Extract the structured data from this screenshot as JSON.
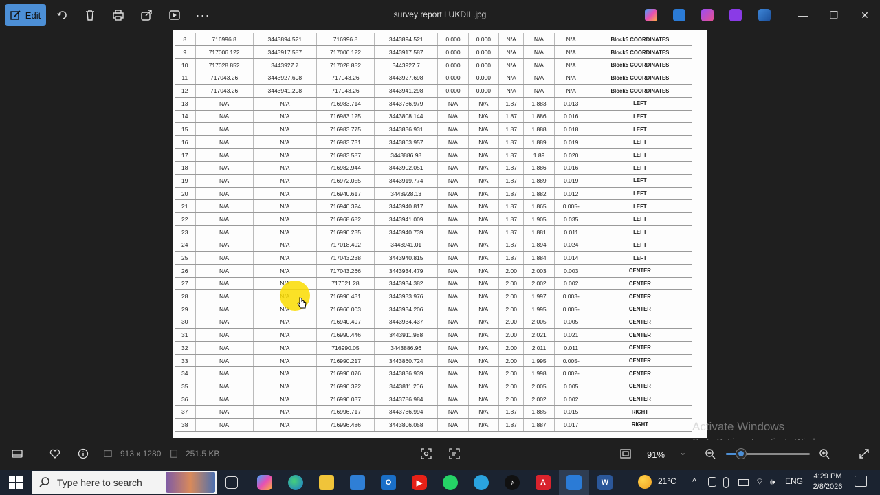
{
  "window": {
    "title": "survey report  LUKDIL.jpg",
    "edit_label": "Edit"
  },
  "table": {
    "rows": [
      [
        "8",
        "716996.8",
        "3443894.521",
        "716996.8",
        "3443894.521",
        "0.000",
        "0.000",
        "N/A",
        "N/A",
        "N/A",
        "Block5 COORDINATES"
      ],
      [
        "9",
        "717006.122",
        "3443917.587",
        "717006.122",
        "3443917.587",
        "0.000",
        "0.000",
        "N/A",
        "N/A",
        "N/A",
        "Block5 COORDINATES"
      ],
      [
        "10",
        "717028.852",
        "3443927.7",
        "717028.852",
        "3443927.7",
        "0.000",
        "0.000",
        "N/A",
        "N/A",
        "N/A",
        "Block5 COORDINATES"
      ],
      [
        "11",
        "717043.26",
        "3443927.698",
        "717043.26",
        "3443927.698",
        "0.000",
        "0.000",
        "N/A",
        "N/A",
        "N/A",
        "Block5 COORDINATES"
      ],
      [
        "12",
        "717043.26",
        "3443941.298",
        "717043.26",
        "3443941.298",
        "0.000",
        "0.000",
        "N/A",
        "N/A",
        "N/A",
        "Block5 COORDINATES"
      ],
      [
        "13",
        "N/A",
        "N/A",
        "716983.714",
        "3443786.979",
        "N/A",
        "N/A",
        "1.87",
        "1.883",
        "0.013",
        "LEFT"
      ],
      [
        "14",
        "N/A",
        "N/A",
        "716983.125",
        "3443808.144",
        "N/A",
        "N/A",
        "1.87",
        "1.886",
        "0.016",
        "LEFT"
      ],
      [
        "15",
        "N/A",
        "N/A",
        "716983.775",
        "3443836.931",
        "N/A",
        "N/A",
        "1.87",
        "1.888",
        "0.018",
        "LEFT"
      ],
      [
        "16",
        "N/A",
        "N/A",
        "716983.731",
        "3443863.957",
        "N/A",
        "N/A",
        "1.87",
        "1.889",
        "0.019",
        "LEFT"
      ],
      [
        "17",
        "N/A",
        "N/A",
        "716983.587",
        "3443886.98",
        "N/A",
        "N/A",
        "1.87",
        "1.89",
        "0.020",
        "LEFT"
      ],
      [
        "18",
        "N/A",
        "N/A",
        "716982.944",
        "3443902.051",
        "N/A",
        "N/A",
        "1.87",
        "1.886",
        "0.016",
        "LEFT"
      ],
      [
        "19",
        "N/A",
        "N/A",
        "716972.055",
        "3443919.774",
        "N/A",
        "N/A",
        "1.87",
        "1.889",
        "0.019",
        "LEFT"
      ],
      [
        "20",
        "N/A",
        "N/A",
        "716940.617",
        "3443928.13",
        "N/A",
        "N/A",
        "1.87",
        "1.882",
        "0.012",
        "LEFT"
      ],
      [
        "21",
        "N/A",
        "N/A",
        "716940.324",
        "3443940.817",
        "N/A",
        "N/A",
        "1.87",
        "1.865",
        "0.005-",
        "LEFT"
      ],
      [
        "22",
        "N/A",
        "N/A",
        "716968.682",
        "3443941.009",
        "N/A",
        "N/A",
        "1.87",
        "1.905",
        "0.035",
        "LEFT"
      ],
      [
        "23",
        "N/A",
        "N/A",
        "716990.235",
        "3443940.739",
        "N/A",
        "N/A",
        "1.87",
        "1.881",
        "0.011",
        "LEFT"
      ],
      [
        "24",
        "N/A",
        "N/A",
        "717018.492",
        "3443941.01",
        "N/A",
        "N/A",
        "1.87",
        "1.894",
        "0.024",
        "LEFT"
      ],
      [
        "25",
        "N/A",
        "N/A",
        "717043.238",
        "3443940.815",
        "N/A",
        "N/A",
        "1.87",
        "1.884",
        "0.014",
        "LEFT"
      ],
      [
        "26",
        "N/A",
        "N/A",
        "717043.266",
        "3443934.479",
        "N/A",
        "N/A",
        "2.00",
        "2.003",
        "0.003",
        "CENTER"
      ],
      [
        "27",
        "N/A",
        "N/A",
        "717021.28",
        "3443934.382",
        "N/A",
        "N/A",
        "2.00",
        "2.002",
        "0.002",
        "CENTER"
      ],
      [
        "28",
        "N/A",
        "N/A",
        "716990.431",
        "3443933.976",
        "N/A",
        "N/A",
        "2.00",
        "1.997",
        "0.003-",
        "CENTER"
      ],
      [
        "29",
        "N/A",
        "N/A",
        "716966.003",
        "3443934.206",
        "N/A",
        "N/A",
        "2.00",
        "1.995",
        "0.005-",
        "CENTER"
      ],
      [
        "30",
        "N/A",
        "N/A",
        "716940.497",
        "3443934.437",
        "N/A",
        "N/A",
        "2.00",
        "2.005",
        "0.005",
        "CENTER"
      ],
      [
        "31",
        "N/A",
        "N/A",
        "716990.446",
        "3443911.988",
        "N/A",
        "N/A",
        "2.00",
        "2.021",
        "0.021",
        "CENTER"
      ],
      [
        "32",
        "N/A",
        "N/A",
        "716990.05",
        "3443886.96",
        "N/A",
        "N/A",
        "2.00",
        "2.011",
        "0.011",
        "CENTER"
      ],
      [
        "33",
        "N/A",
        "N/A",
        "716990.217",
        "3443860.724",
        "N/A",
        "N/A",
        "2.00",
        "1.995",
        "0.005-",
        "CENTER"
      ],
      [
        "34",
        "N/A",
        "N/A",
        "716990.076",
        "3443836.939",
        "N/A",
        "N/A",
        "2.00",
        "1.998",
        "0.002-",
        "CENTER"
      ],
      [
        "35",
        "N/A",
        "N/A",
        "716990.322",
        "3443811.206",
        "N/A",
        "N/A",
        "2.00",
        "2.005",
        "0.005",
        "CENTER"
      ],
      [
        "36",
        "N/A",
        "N/A",
        "716990.037",
        "3443786.984",
        "N/A",
        "N/A",
        "2.00",
        "2.002",
        "0.002",
        "CENTER"
      ],
      [
        "37",
        "N/A",
        "N/A",
        "716996.717",
        "3443786.994",
        "N/A",
        "N/A",
        "1.87",
        "1.885",
        "0.015",
        "RIGHT"
      ],
      [
        "38",
        "N/A",
        "N/A",
        "716996.486",
        "3443806.058",
        "N/A",
        "N/A",
        "1.87",
        "1.887",
        "0.017",
        "RIGHT"
      ]
    ]
  },
  "watermark": {
    "line1": "Activate Windows",
    "line2": "Go to Settings to activate Windows."
  },
  "statusbar": {
    "dimensions": "913 x 1280",
    "filesize": "251.5 KB",
    "zoom": "91%",
    "zoom_level": 0.18
  },
  "taskbar": {
    "search_placeholder": "Type here to search",
    "temperature": "21°C",
    "language": "ENG",
    "time": "4:29 PM",
    "date": "2/8/2026"
  },
  "colors": {
    "accent": "#4c8fd6",
    "highlight": "#fadc00",
    "taskbar": "#1b2330"
  }
}
